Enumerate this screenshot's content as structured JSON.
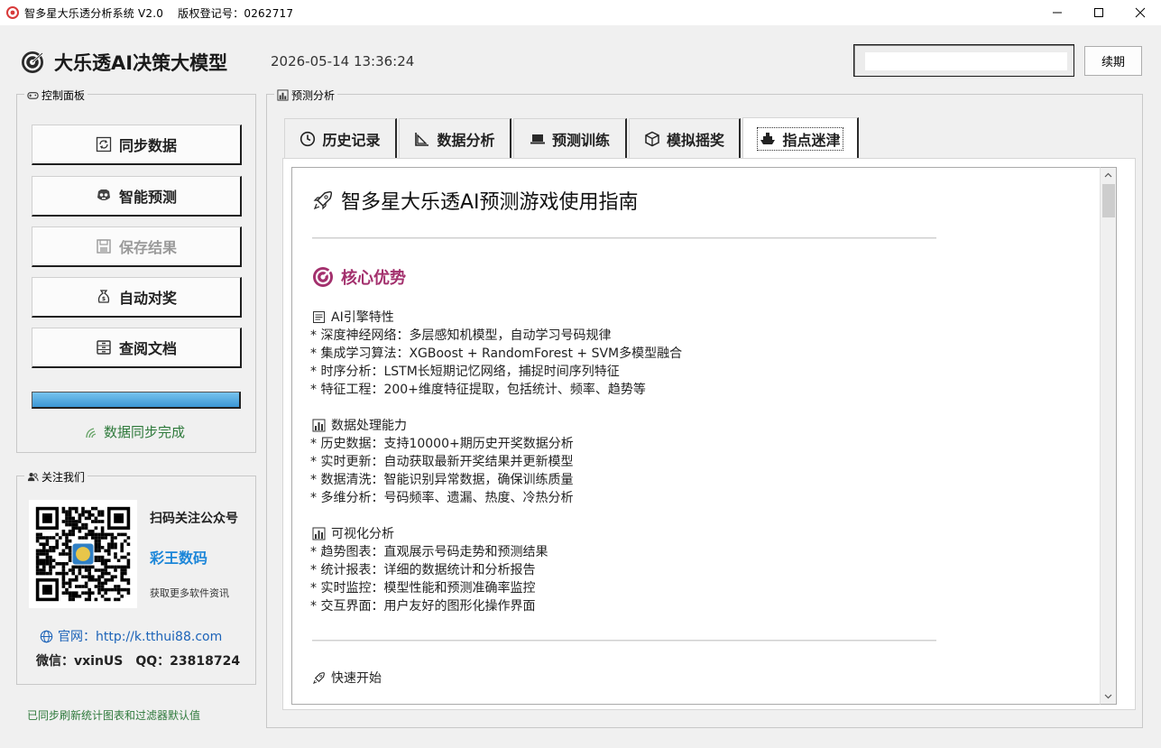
{
  "window": {
    "title": "智多星大乐透分析系统 V2.0    版权登记号：0262717",
    "icon": "app-target-icon"
  },
  "header": {
    "app_name": "大乐透AI决策大模型",
    "clock": "2026-05-14 13:36:24",
    "license_value": "",
    "renew_label": "续期"
  },
  "control_panel": {
    "legend": "控制面板",
    "buttons": [
      {
        "label": "同步数据",
        "icon": "sync-icon",
        "enabled": true
      },
      {
        "label": "智能预测",
        "icon": "robot-icon",
        "enabled": true
      },
      {
        "label": "保存结果",
        "icon": "save-icon",
        "enabled": false
      },
      {
        "label": "自动对奖",
        "icon": "money-bag-icon",
        "enabled": true
      },
      {
        "label": "查阅文档",
        "icon": "cabinet-icon",
        "enabled": true
      }
    ],
    "progress_percent": 100,
    "sync_status": "数据同步完成"
  },
  "follow_us": {
    "legend": "关注我们",
    "scan_title": "扫码关注公众号",
    "brand": "彩王数码",
    "more_info": "获取更多软件资讯",
    "website": "官网：http://k.tthui88.com",
    "wechat": "微信：vxinUS",
    "qq": "QQ：23818724"
  },
  "status_bar": "已同步刷新统计图表和过滤器默认值",
  "prediction": {
    "legend": "预测分析",
    "tabs": [
      {
        "label": "历史记录",
        "icon": "clock-icon"
      },
      {
        "label": "数据分析",
        "icon": "chart-icon"
      },
      {
        "label": "预测训练",
        "icon": "laptop-icon"
      },
      {
        "label": "模拟摇奖",
        "icon": "cube-icon"
      },
      {
        "label": "指点迷津",
        "icon": "ship-icon",
        "active": true
      }
    ]
  },
  "guide": {
    "title": "智多星大乐透AI预测游戏使用指南",
    "section": "核心优势",
    "groups": [
      {
        "heading": "AI引擎特性",
        "icon": "memo-icon",
        "items": [
          "* 深度神经网络：多层感知机模型，自动学习号码规律",
          "* 集成学习算法：XGBoost + RandomForest + SVM多模型融合",
          "* 时序分析：LSTM长短期记忆网络，捕捉时间序列特征",
          "* 特征工程：200+维度特征提取，包括统计、频率、趋势等"
        ]
      },
      {
        "heading": "数据处理能力",
        "icon": "bar-chart-icon",
        "items": [
          "* 历史数据：支持10000+期历史开奖数据分析",
          "* 实时更新：自动获取最新开奖结果并更新模型",
          "* 数据清洗：智能识别异常数据，确保训练质量",
          "* 多维分析：号码频率、遗漏、热度、冷热分析"
        ]
      },
      {
        "heading": "可视化分析",
        "icon": "bar-chart-icon",
        "items": [
          "* 趋势图表：直观展示号码走势和预测结果",
          "* 统计报表：详细的数据统计和分析报告",
          "* 实时监控：模型性能和预测准确率监控",
          "* 交互界面：用户友好的图形化操作界面"
        ]
      }
    ],
    "quick_start": "快速开始"
  },
  "colors": {
    "accent_magenta": "#a3306d",
    "link_blue": "#1c63b8",
    "brand_blue": "#1c86d8",
    "status_green": "#2f7a3c",
    "progress_blue": "#3f9ad6"
  }
}
